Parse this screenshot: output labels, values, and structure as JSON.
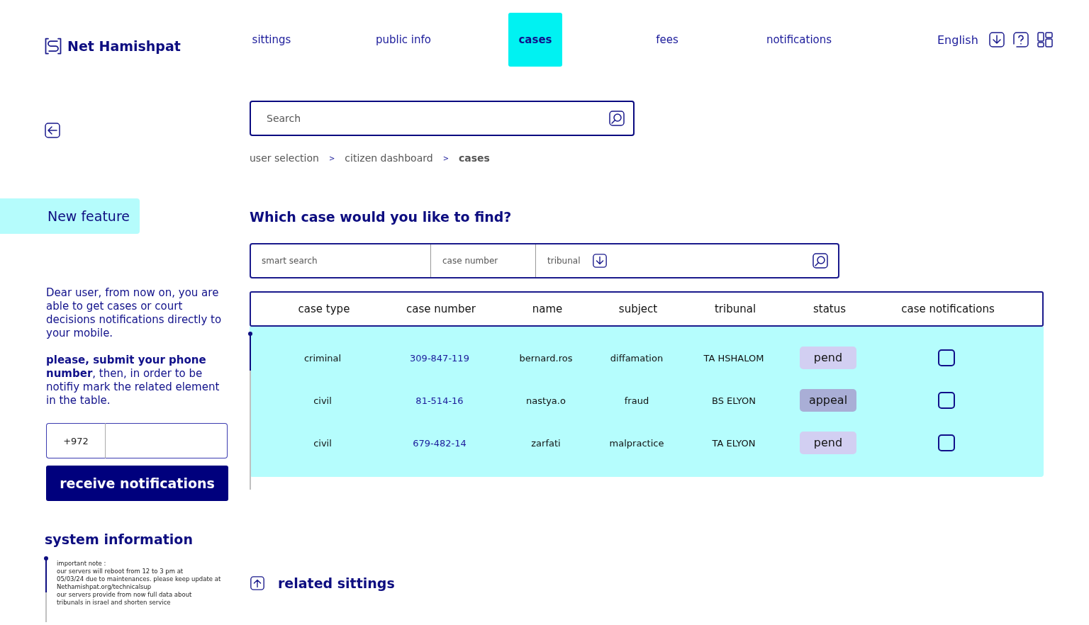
{
  "brand": {
    "name": "Net Hamishpat"
  },
  "nav": [
    {
      "label": "sittings",
      "selected": false
    },
    {
      "label": "public info",
      "selected": false
    },
    {
      "label": "cases",
      "selected": true
    },
    {
      "label": "fees",
      "selected": false
    },
    {
      "label": "notifications",
      "selected": false
    }
  ],
  "language": "English",
  "search": {
    "placeholder": "Search"
  },
  "breadcrumb": [
    "user selection",
    "citizen dashboard",
    "cases"
  ],
  "breadcrumb_separator": ">",
  "sidebar": {
    "feature_label": "New feature",
    "message": "Dear user, from now on, you are able to get cases or court decisions notifications directly to your mobile.",
    "instruction": "**please, submit your phone number**, then, in order to be notifiy mark  the related element in the table.",
    "phone_prefix": "+972",
    "button": "receive notifications",
    "system_title": "system information",
    "note_lines": [
      "important note :",
      "our servers will reboot from 12 to 3 pm at",
      "05/03/24 due to maintenances. please keep update at",
      "Nethamishpat.org/technicalsup",
      "our servers provide from now full data about",
      "tribunals in israel and shorten service"
    ]
  },
  "question": "Which case would you like to find?",
  "filters": {
    "smart_search": "smart search",
    "case_number": "case number",
    "tribunal": "tribunal"
  },
  "table": {
    "columns": [
      "case type",
      "case number",
      "name",
      "subject",
      "tribunal",
      "status",
      "case notifications"
    ],
    "rows": [
      {
        "case_type": "criminal",
        "case_number": "309-847-119",
        "name": "bernard.ros",
        "subject": "diffamation",
        "tribunal": "TA HSHALOM",
        "status": "pend",
        "color": "#d2cff2",
        "notify": false
      },
      {
        "case_type": "civil",
        "case_number": "81-514-16",
        "name": "nastya.o",
        "subject": "fraud",
        "tribunal": "BS ELYON",
        "status": "appeal",
        "color": "#a9aed6",
        "notify": false
      },
      {
        "case_type": "civil",
        "case_number": "679-482-14",
        "name": "zarfati",
        "subject": "malpractice",
        "tribunal": "TA ELYON",
        "status": "pend",
        "color": "#d2cff2",
        "notify": false
      }
    ]
  },
  "related": "related sittings"
}
